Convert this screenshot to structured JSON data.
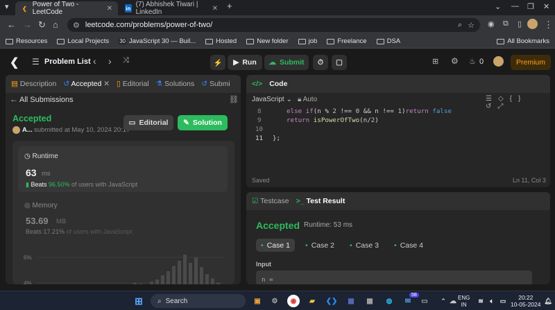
{
  "browser": {
    "tabs": [
      {
        "title": "Power of Two - LeetCode",
        "favicon": "leetcode-icon",
        "active": true
      },
      {
        "title": "(7) Abhishek Tiwari | LinkedIn",
        "favicon": "linkedin-icon",
        "active": false
      }
    ],
    "new_tab": "+",
    "url": "leetcode.com/problems/power-of-two/",
    "bookmarks": [
      {
        "label": "Resources"
      },
      {
        "label": "Local Projects"
      },
      {
        "label": "JavaScript 30 — Buil..."
      },
      {
        "label": "Hosted"
      },
      {
        "label": "New folder"
      },
      {
        "label": "job"
      },
      {
        "label": "Freelance"
      },
      {
        "label": "DSA"
      }
    ],
    "all_bookmarks": "All Bookmarks"
  },
  "lc_header": {
    "problem_list": "Problem List",
    "run": "Run",
    "submit": "Submit",
    "streak_count": "0",
    "premium": "Premium"
  },
  "left_pane": {
    "tabs": [
      "Description",
      "Accepted",
      "Editorial",
      "Solutions",
      "Submi"
    ],
    "back_label": "All Submissions",
    "status": "Accepted",
    "user": "A...",
    "submitted_at": "submitted at May 10, 2024 20:17",
    "editorial_btn": "Editorial",
    "solution_btn": "Solution",
    "runtime": {
      "title": "Runtime",
      "value": "63",
      "unit": "ms",
      "beats_prefix": "Beats",
      "beats_pct": "96.50%",
      "beats_suffix": "of users with JavaScript"
    },
    "memory": {
      "title": "Memory",
      "value": "53.69",
      "unit": "MB",
      "beats_prefix": "Beats",
      "beats_pct": "17.21%",
      "beats_suffix": "of users with JavaScript"
    },
    "chart_labels": [
      "6%",
      "4%"
    ]
  },
  "chart_data": {
    "type": "bar",
    "ylabel": "",
    "ytick_labels": [
      "6%",
      "4%"
    ],
    "values": [
      0.3,
      0.2,
      0.5,
      0.4,
      0.3,
      0.6,
      0.8,
      1.2,
      1.6,
      2.1,
      2.6,
      3.2,
      2.4,
      2.9,
      2.0,
      1.3,
      0.9,
      0.5
    ]
  },
  "code_pane": {
    "title": "Code",
    "language": "JavaScript",
    "mode": "Auto",
    "lines": [
      {
        "num": "8",
        "text": "else if(n % 2 !== 0 && n !== 1)return false"
      },
      {
        "num": "9",
        "text": "return isPowerOfTwo(n/2)"
      },
      {
        "num": "10",
        "text": ""
      },
      {
        "num": "11",
        "text": "};"
      }
    ],
    "saved": "Saved",
    "cursor": "Ln 11, Col 3"
  },
  "result_pane": {
    "tab_testcase": "Testcase",
    "tab_result": "Test Result",
    "status": "Accepted",
    "runtime": "Runtime: 53 ms",
    "cases": [
      "Case 1",
      "Case 2",
      "Case 3",
      "Case 4"
    ],
    "input_label": "Input",
    "input_value": "n ="
  },
  "taskbar": {
    "search": "Search",
    "badge": "58",
    "lang_top": "ENG",
    "lang_bottom": "IN",
    "time": "20:22",
    "date": "10-05-2024"
  }
}
